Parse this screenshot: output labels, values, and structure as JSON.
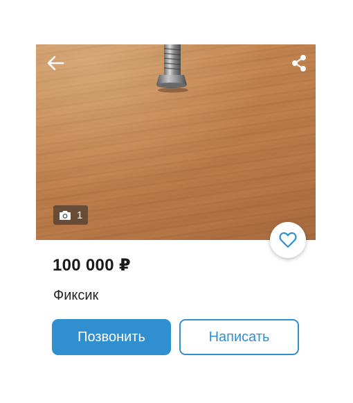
{
  "listing": {
    "price": "100 000 ₽",
    "title": "Фиксик",
    "photo_count": "1"
  },
  "icons": {
    "back": "arrow-left-icon",
    "share": "share-icon",
    "camera": "camera-icon",
    "favorite": "heart-outline-icon"
  },
  "actions": {
    "call_label": "Позвонить",
    "write_label": "Написать"
  },
  "colors": {
    "accent": "#2f8fcf",
    "price_text": "#1a1a1a",
    "icon_white": "#ffffff"
  }
}
